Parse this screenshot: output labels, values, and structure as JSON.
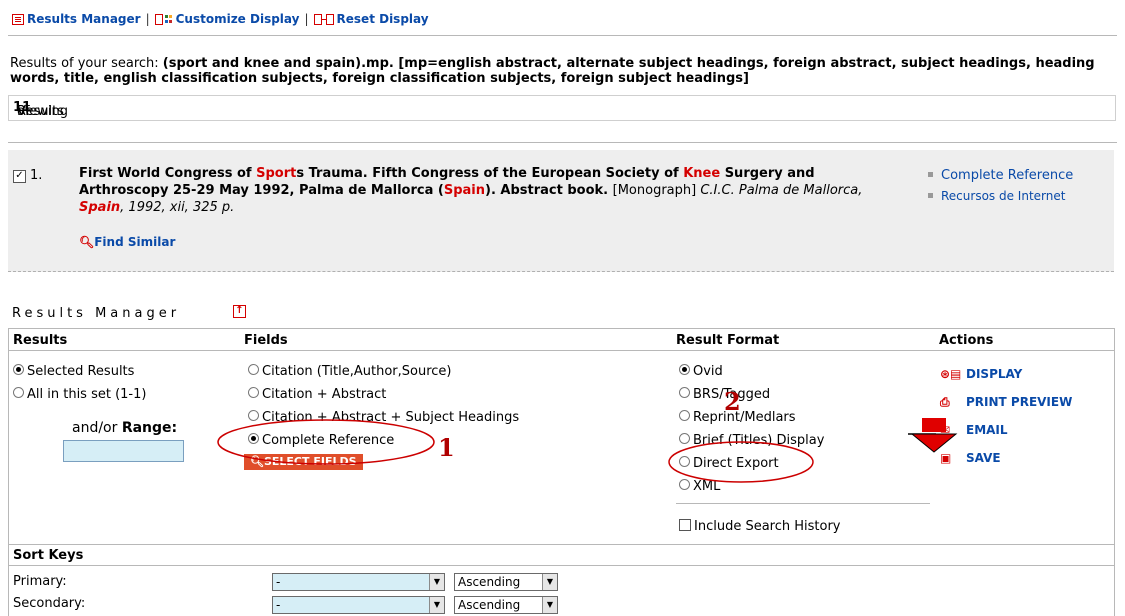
{
  "topnav": {
    "results_manager": "Results Manager",
    "customize_display": "Customize Display",
    "reset_display": "Reset Display"
  },
  "search": {
    "prefix": "Results of your search: ",
    "query": "(sport and knee and spain).mp. [mp=english abstract, alternate subject headings, foreign abstract, subject headings, heading words, title, english classification subjects, foreign classification subjects, foreign subject headings]"
  },
  "viewing": {
    "pre": "Viewing ",
    "current": "1",
    "of": " of ",
    "total": "1",
    "post": " Results"
  },
  "result": {
    "number": "1.",
    "title_parts": [
      "First World Congress of ",
      "Sport",
      "s Trauma. Fifth Congress of the European Society of ",
      "Knee",
      " Surgery and Arthroscopy 25-29 May 1992, Palma de Mallorca (",
      "Spain",
      "). Abstract book. "
    ],
    "type": "[Monograph]",
    "source_a": " C.I.C. Palma de Mallorca, ",
    "source_hl": "Spain",
    "source_b": ", 1992, xii, 325 p.",
    "find_similar": "Find Similar",
    "links": [
      "Complete Reference",
      "Recursos de Internet"
    ]
  },
  "manager": {
    "title": "Results Manager",
    "headers": {
      "results": "Results",
      "fields": "Fields",
      "format": "Result Format",
      "actions": "Actions"
    },
    "results_opts": [
      "Selected Results",
      "All in this set (1-1)"
    ],
    "range_label_pre": "and/or ",
    "range_label": "Range:",
    "fields_opts": [
      "Citation (Title,Author,Source)",
      "Citation + Abstract",
      "Citation + Abstract + Subject Headings",
      "Complete Reference"
    ],
    "select_fields": "SELECT FIELDS",
    "format_opts": [
      "Ovid",
      "BRS/Tagged",
      "Reprint/Medlars",
      "Brief (Titles) Display",
      "Direct Export",
      "XML"
    ],
    "include_history": "Include Search History",
    "actions": [
      "DISPLAY",
      "PRINT PREVIEW",
      "EMAIL",
      "SAVE"
    ],
    "sort_keys": "Sort Keys",
    "primary": "Primary:",
    "secondary": "Secondary:",
    "primary_value": "-",
    "secondary_value": "-",
    "primary_order": "Ascending",
    "secondary_order": "Ascending"
  },
  "annotations": [
    "1",
    "2"
  ]
}
